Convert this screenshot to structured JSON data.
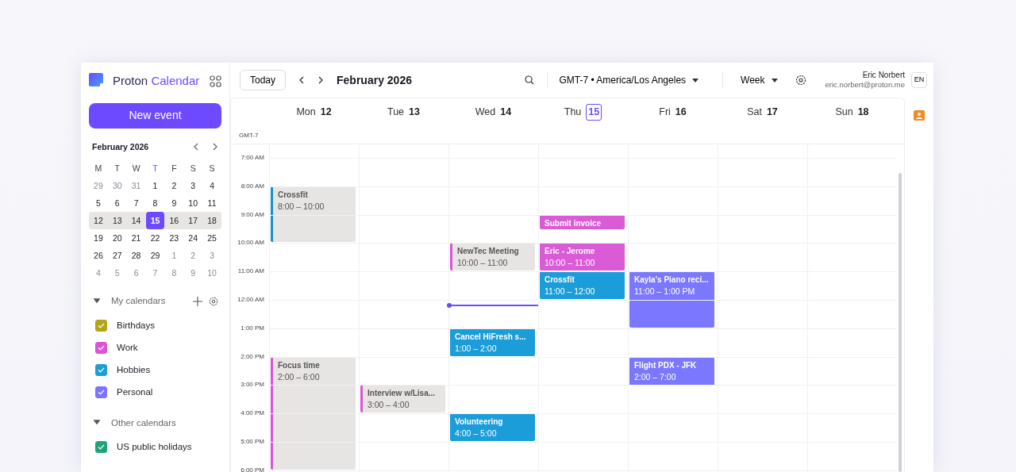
{
  "app": {
    "logo_text": "Proton Calendar",
    "new_event": "New event"
  },
  "mini_calendar": {
    "title": "February 2026",
    "weekdays": [
      {
        "label": "M",
        "today": false
      },
      {
        "label": "T",
        "today": false
      },
      {
        "label": "W",
        "today": false
      },
      {
        "label": "T",
        "today": true
      },
      {
        "label": "F",
        "today": false
      },
      {
        "label": "S",
        "today": false
      },
      {
        "label": "S",
        "today": false
      }
    ],
    "weeks": [
      {
        "selected": false,
        "days": [
          {
            "label": "29",
            "muted": true,
            "selected": false
          },
          {
            "label": "30",
            "muted": true,
            "selected": false
          },
          {
            "label": "31",
            "muted": true,
            "selected": false
          },
          {
            "label": "1",
            "muted": false,
            "selected": false
          },
          {
            "label": "2",
            "muted": false,
            "selected": false
          },
          {
            "label": "3",
            "muted": false,
            "selected": false
          },
          {
            "label": "4",
            "muted": false,
            "selected": false
          }
        ]
      },
      {
        "selected": false,
        "days": [
          {
            "label": "5",
            "muted": false,
            "selected": false
          },
          {
            "label": "6",
            "muted": false,
            "selected": false
          },
          {
            "label": "7",
            "muted": false,
            "selected": false
          },
          {
            "label": "8",
            "muted": false,
            "selected": false
          },
          {
            "label": "9",
            "muted": false,
            "selected": false
          },
          {
            "label": "10",
            "muted": false,
            "selected": false
          },
          {
            "label": "11",
            "muted": false,
            "selected": false
          }
        ]
      },
      {
        "selected": true,
        "days": [
          {
            "label": "12",
            "muted": false,
            "selected": false
          },
          {
            "label": "13",
            "muted": false,
            "selected": false
          },
          {
            "label": "14",
            "muted": false,
            "selected": false
          },
          {
            "label": "15",
            "muted": false,
            "selected": true
          },
          {
            "label": "16",
            "muted": false,
            "selected": false
          },
          {
            "label": "17",
            "muted": false,
            "selected": false
          },
          {
            "label": "18",
            "muted": false,
            "selected": false
          }
        ]
      },
      {
        "selected": false,
        "days": [
          {
            "label": "19",
            "muted": false,
            "selected": false
          },
          {
            "label": "20",
            "muted": false,
            "selected": false
          },
          {
            "label": "21",
            "muted": false,
            "selected": false
          },
          {
            "label": "22",
            "muted": false,
            "selected": false
          },
          {
            "label": "23",
            "muted": false,
            "selected": false
          },
          {
            "label": "24",
            "muted": false,
            "selected": false
          },
          {
            "label": "25",
            "muted": false,
            "selected": false
          }
        ]
      },
      {
        "selected": false,
        "days": [
          {
            "label": "26",
            "muted": false,
            "selected": false
          },
          {
            "label": "27",
            "muted": false,
            "selected": false
          },
          {
            "label": "28",
            "muted": false,
            "selected": false
          },
          {
            "label": "29",
            "muted": false,
            "selected": false
          },
          {
            "label": "1",
            "muted": true,
            "selected": false
          },
          {
            "label": "2",
            "muted": true,
            "selected": false
          },
          {
            "label": "3",
            "muted": true,
            "selected": false
          }
        ]
      },
      {
        "selected": false,
        "days": [
          {
            "label": "4",
            "muted": true,
            "selected": false
          },
          {
            "label": "5",
            "muted": true,
            "selected": false
          },
          {
            "label": "6",
            "muted": true,
            "selected": false
          },
          {
            "label": "7",
            "muted": true,
            "selected": false
          },
          {
            "label": "8",
            "muted": true,
            "selected": false
          },
          {
            "label": "9",
            "muted": true,
            "selected": false
          },
          {
            "label": "10",
            "muted": true,
            "selected": false
          }
        ]
      }
    ]
  },
  "calendar_groups": [
    {
      "title": "My calendars",
      "expanded": true,
      "has_actions": true,
      "items": [
        {
          "name": "Birthdays",
          "color": "#b3a514",
          "checked": true
        },
        {
          "name": "Work",
          "color": "#da55d6",
          "checked": true
        },
        {
          "name": "Hobbies",
          "color": "#1e9ed6",
          "checked": true
        },
        {
          "name": "Personal",
          "color": "#7b72ff",
          "checked": true
        }
      ]
    },
    {
      "title": "Other calendars",
      "expanded": true,
      "items": [
        {
          "name": "US public holidays",
          "color": "#1ea47a",
          "checked": true
        }
      ]
    }
  ],
  "toolbar": {
    "today": "Today",
    "period": "February 2026",
    "timezone": "GMT-7 • America/Los Angeles",
    "view": "Week",
    "user_name": "Eric Norbert",
    "user_email": "eric.norbert@proton.me",
    "language": "EN"
  },
  "timezone_label": "GMT-7",
  "hours": [
    "7:00 AM",
    "8:00 AM",
    "9:00 AM",
    "10:00 AM",
    "11:00 AM",
    "12:00 AM",
    "1:00 PM",
    "2:00 PM",
    "3:00 PM",
    "4:00 PM",
    "5:00 PM",
    "6:00 PM"
  ],
  "days": [
    {
      "weekday": "Mon",
      "date": "12",
      "today": false,
      "events": [
        {
          "title": "Crossfit",
          "time": "8:00 – 10:00",
          "kind": "faded",
          "color": "#1a8fc9"
        },
        {
          "title": "Focus time",
          "time": "2:00 – 6:00",
          "kind": "faded",
          "color": "#da55d6"
        }
      ]
    },
    {
      "weekday": "Tue",
      "date": "13",
      "today": false,
      "events": [
        {
          "title": "Interview w/Lisa...",
          "time": "3:00 – 4:00",
          "kind": "faded",
          "color": "#da55d6"
        }
      ]
    },
    {
      "weekday": "Wed",
      "date": "14",
      "today": false,
      "now_line": true,
      "events": [
        {
          "title": "NewTec Meeting",
          "time": "10:00 – 11:00",
          "kind": "faded",
          "color": "#da55d6"
        },
        {
          "title": "Cancel HiFresh s...",
          "time": "1:00 – 2:00",
          "kind": "solid",
          "color": "#1a9dd9"
        },
        {
          "title": "Volunteering",
          "time": "4:00 – 5:00",
          "kind": "solid",
          "color": "#1a9dd9"
        }
      ]
    },
    {
      "weekday": "Thu",
      "date": "15",
      "today": true,
      "events": [
        {
          "title": "Submit invoice",
          "kind": "solid",
          "color": "#d95bd6"
        },
        {
          "title": "Eric - Jerome",
          "time": "10:00 – 11:00",
          "kind": "solid",
          "color": "#d95bd6"
        },
        {
          "title": "Crossfit",
          "time": "11:00 – 12:00",
          "kind": "solid",
          "color": "#1a9dd9"
        }
      ]
    },
    {
      "weekday": "Fri",
      "date": "16",
      "today": false,
      "events": [
        {
          "title": "Kayla's Piano reci...",
          "time": "11:00 – 1:00 PM",
          "kind": "solid",
          "color": "#7b78ff"
        },
        {
          "title": "Flight PDX - JFK",
          "time": "2:00 – 7:00",
          "kind": "solid",
          "color": "#7b78ff"
        }
      ]
    },
    {
      "weekday": "Sat",
      "date": "17",
      "today": false
    },
    {
      "weekday": "Sun",
      "date": "18",
      "today": false
    }
  ]
}
